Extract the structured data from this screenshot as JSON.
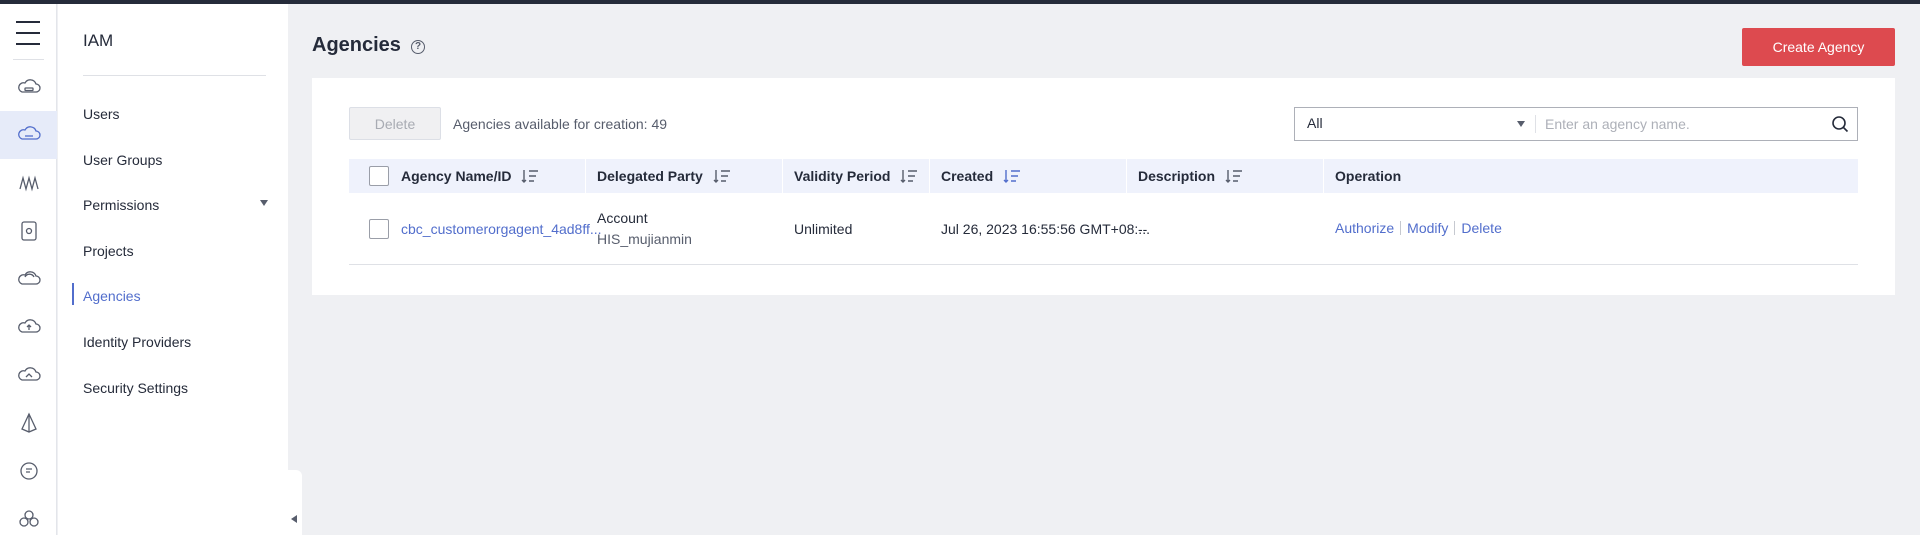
{
  "colors": {
    "accent": "#526ecc",
    "danger_button": "#dd4a4f",
    "table_header": "#eff2fc"
  },
  "rail": {
    "menu_icon": "hamburger-icon",
    "icons": [
      "cloud-server-icon",
      "cloud-active-icon",
      "network-icon",
      "storage-icon",
      "cloud-icon",
      "cloud-upload-icon",
      "cloud-sync-icon",
      "pyramid-icon",
      "badge-icon",
      "cluster-icon"
    ]
  },
  "nav": {
    "title": "IAM",
    "items": [
      {
        "label": "Users"
      },
      {
        "label": "User Groups"
      },
      {
        "label": "Permissions"
      },
      {
        "label": "Projects"
      },
      {
        "label": "Agencies"
      },
      {
        "label": "Identity Providers"
      },
      {
        "label": "Security Settings"
      }
    ],
    "active_item": "Agencies"
  },
  "header": {
    "title": "Agencies",
    "help_glyph": "?",
    "create_button": "Create Agency"
  },
  "toolbar": {
    "delete_button": "Delete",
    "available_text": "Agencies available for creation: 49"
  },
  "search": {
    "filter_value": "All",
    "placeholder": "Enter an agency name."
  },
  "table": {
    "columns": [
      "Agency Name/ID",
      "Delegated Party",
      "Validity Period",
      "Created",
      "Description",
      "Operation"
    ],
    "sorted_column": "Created",
    "rows": [
      {
        "name": "cbc_customerorgagent_4ad8ff...",
        "party_type": "Account",
        "party_name": "HIS_mujianmin",
        "validity": "Unlimited",
        "created": "Jul 26, 2023 16:55:56 GMT+08:...",
        "description": "--",
        "operations": [
          "Authorize",
          "Modify",
          "Delete"
        ]
      }
    ]
  }
}
